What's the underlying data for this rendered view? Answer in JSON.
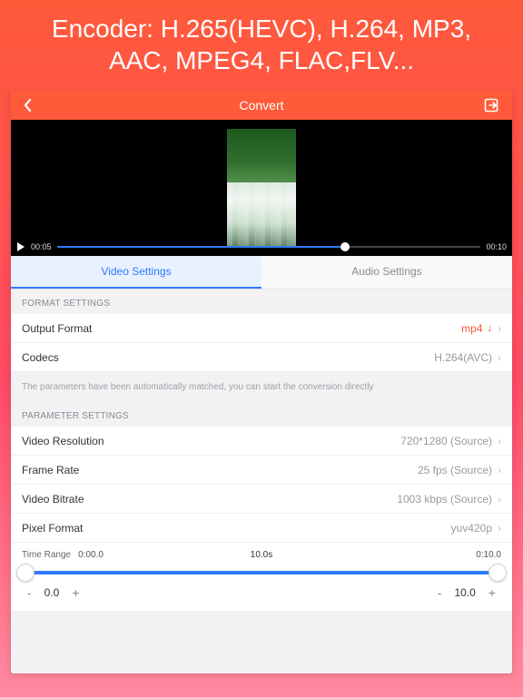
{
  "promo": {
    "line1": "Encoder: H.265(HEVC), H.264, MP3,",
    "line2": "AAC, MPEG4, FLAC,FLV..."
  },
  "navbar": {
    "title": "Convert"
  },
  "player": {
    "current": "00:05",
    "total": "00:10",
    "progress_pct": 68
  },
  "tabs": {
    "video": "Video Settings",
    "audio": "Audio Settings",
    "active": "video"
  },
  "sections": {
    "format_header": "FORMAT SETTINGS",
    "param_header": "PARAMETER SETTINGS",
    "note": "The parameters have been automatically matched, you can start the conversion directly"
  },
  "rows": {
    "output_format": {
      "label": "Output Format",
      "value": "mp4"
    },
    "codecs": {
      "label": "Codecs",
      "value": "H.264(AVC)"
    },
    "resolution": {
      "label": "Video Resolution",
      "value": "720*1280 (Source)"
    },
    "frame_rate": {
      "label": "Frame Rate",
      "value": "25 fps (Source)"
    },
    "bitrate": {
      "label": "Video Bitrate",
      "value": "1003 kbps (Source)"
    },
    "pixel_format": {
      "label": "Pixel Format",
      "value": "yuv420p"
    }
  },
  "time_range": {
    "label": "Time Range",
    "start": "0:00.0",
    "mid": "10.0s",
    "end": "0:10.0",
    "stepper_start": "0.0",
    "stepper_end": "10.0",
    "minus": "-",
    "plus": "+"
  }
}
